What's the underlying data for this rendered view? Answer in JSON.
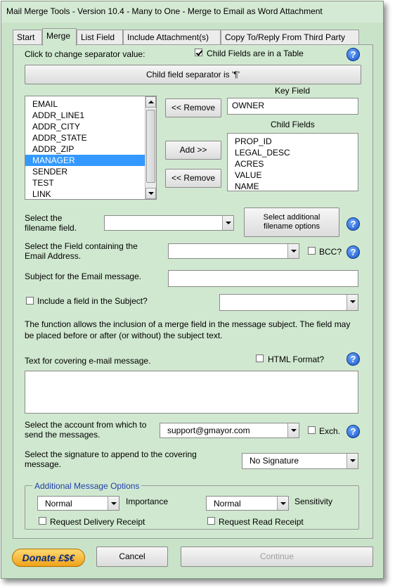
{
  "window": {
    "title": "Mail Merge Tools - Version 10.4 - Many to One - Merge to Email as Word Attachment"
  },
  "tabs": [
    {
      "label": "Start"
    },
    {
      "label": "Merge"
    },
    {
      "label": "List Field"
    },
    {
      "label": "Include Attachment(s)"
    },
    {
      "label": "Copy To/Reply From Third Party"
    }
  ],
  "merge": {
    "separator_prompt": "Click to change separator value:",
    "child_table_label": "Child Fields are in a Table",
    "child_table_checked": true,
    "separator_button": "Child field separator is '¶'",
    "available_fields": [
      "EMAIL",
      "ADDR_LINE1",
      "ADDR_CITY",
      "ADDR_STATE",
      "ADDR_ZIP",
      "MANAGER",
      "SENDER",
      "TEST",
      "LINK"
    ],
    "selected_field": "MANAGER",
    "remove_key_button": "<< Remove",
    "key_field_label": "Key Field",
    "key_field_value": "OWNER",
    "child_fields_label": "Child Fields",
    "child_fields": [
      "PROP_ID",
      "LEGAL_DESC",
      "ACRES",
      "VALUE",
      "NAME"
    ],
    "add_button": "Add >>",
    "remove_child_button": "<< Remove",
    "filename_label": "Select the filename field.",
    "filename_value": "",
    "filename_options_button": "Select additional filename options",
    "email_field_label": "Select the Field containing the Email Address.",
    "email_field_value": "",
    "bcc_label": "BCC?",
    "bcc_checked": false,
    "subject_label": "Subject for the Email message.",
    "subject_value": "",
    "include_field_label": "Include a field in the Subject?",
    "include_field_checked": false,
    "include_field_value": "",
    "info_text": "The function allows the inclusion of a merge field in the message subject. The field may be placed before or after (or without) the subject text.",
    "covering_text_label": "Text for covering e-mail message.",
    "html_format_label": "HTML Format?",
    "html_format_checked": false,
    "covering_text_value": "",
    "account_label": "Select the account from which to send the messages.",
    "account_value": "support@gmayor.com",
    "exch_label": "Exch.",
    "exch_checked": false,
    "signature_label": "Select the signature to append to the covering message.",
    "signature_value": "No Signature",
    "options_group_title": "Additional Message Options",
    "importance_value": "Normal",
    "importance_label": "Importance",
    "sensitivity_value": "Normal",
    "sensitivity_label": "Sensitivity",
    "delivery_receipt_label": "Request Delivery Receipt",
    "delivery_receipt_checked": false,
    "read_receipt_label": "Request Read Receipt",
    "read_receipt_checked": false
  },
  "footer": {
    "donate_label": "Donate £$€",
    "cancel_label": "Cancel",
    "continue_label": "Continue"
  },
  "icons": {
    "help": "help-icon"
  },
  "colors": {
    "window_bg": "#c9e3c9",
    "panel_bg": "#d0e8d0",
    "selection": "#3399ff",
    "group_title": "#1f3fa8",
    "donate_gold": "#f0a21a"
  }
}
